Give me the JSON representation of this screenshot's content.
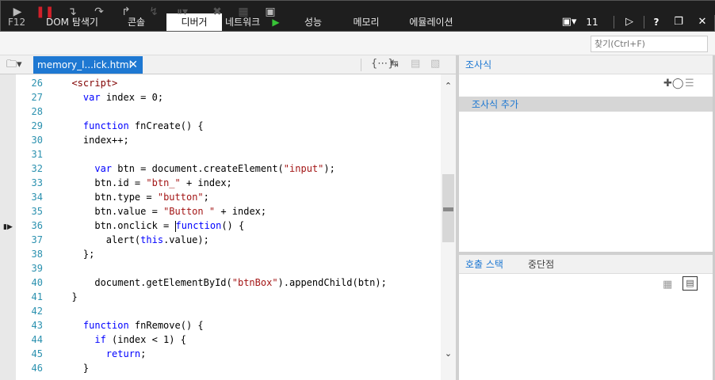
{
  "top_tabs": {
    "f12": "F12",
    "dom": "DOM 탐색기",
    "console": "콘솔",
    "debugger": "디버거",
    "network": "네트워크",
    "performance": "성능",
    "memory": "메모리",
    "emulation": "에뮬레이션",
    "target_count": "11",
    "help": "?"
  },
  "toolbar": {
    "find_placeholder": "찾기(Ctrl+F)"
  },
  "document": {
    "file_tab": "memory_l...ick.html"
  },
  "code": {
    "lines": [
      {
        "n": "26",
        "text": ""
      },
      {
        "n": "27",
        "text": ""
      },
      {
        "n": "28",
        "text": ""
      },
      {
        "n": "29",
        "text": ""
      },
      {
        "n": "30",
        "text": "    index++;"
      },
      {
        "n": "31",
        "text": ""
      },
      {
        "n": "32",
        "text": ""
      },
      {
        "n": "33",
        "text": ""
      },
      {
        "n": "34",
        "text": ""
      },
      {
        "n": "35",
        "text": ""
      },
      {
        "n": "36",
        "text": ""
      },
      {
        "n": "37",
        "text": ""
      },
      {
        "n": "38",
        "text": "    };"
      },
      {
        "n": "39",
        "text": ""
      },
      {
        "n": "40",
        "text": ""
      },
      {
        "n": "41",
        "text": "  }"
      },
      {
        "n": "42",
        "text": ""
      },
      {
        "n": "43",
        "text": ""
      },
      {
        "n": "44",
        "text": ""
      },
      {
        "n": "45",
        "text": ""
      },
      {
        "n": "46",
        "text": "    }"
      }
    ],
    "tokens": {
      "l26_tag": "<script>",
      "l27_kw": "var",
      "l27_rest": " index = 0;",
      "l29_kw": "function",
      "l29_rest": " fnCreate() {",
      "l32_kw": "var",
      "l32_a": " btn = document.createElement(",
      "l32_str": "\"input\"",
      "l32_b": ");",
      "l33_a": "btn.id = ",
      "l33_str": "\"btn_\"",
      "l33_b": " + index;",
      "l34_a": "btn.type = ",
      "l34_str": "\"button\"",
      "l34_b": ";",
      "l35_a": "btn.value = ",
      "l35_str": "\"Button \"",
      "l35_b": " + index;",
      "l36_a": "btn.onclick = ",
      "l36_kw": "function",
      "l36_b": "() {",
      "l37_a": "alert(",
      "l37_kw": "this",
      "l37_b": ".value);",
      "l40_a": "document.getElementById(",
      "l40_str": "\"btnBox\"",
      "l40_b": ").appendChild(btn);",
      "l43_kw": "function",
      "l43_rest": " fnRemove() {",
      "l44_kw": "if",
      "l44_rest": " (index < 1) {",
      "l45_kw": "return",
      "l45_rest": ";"
    }
  },
  "watch": {
    "title": "조사식",
    "add_label": "조사식 추가"
  },
  "bottom_panel": {
    "call_stack_tab": "호출 스택",
    "breakpoints_tab": "중단점"
  },
  "colors": {
    "accent": "#1e78d2",
    "keyword": "#0000ff",
    "string": "#a31515",
    "tag": "#800000",
    "line_number": "#2b91af"
  }
}
